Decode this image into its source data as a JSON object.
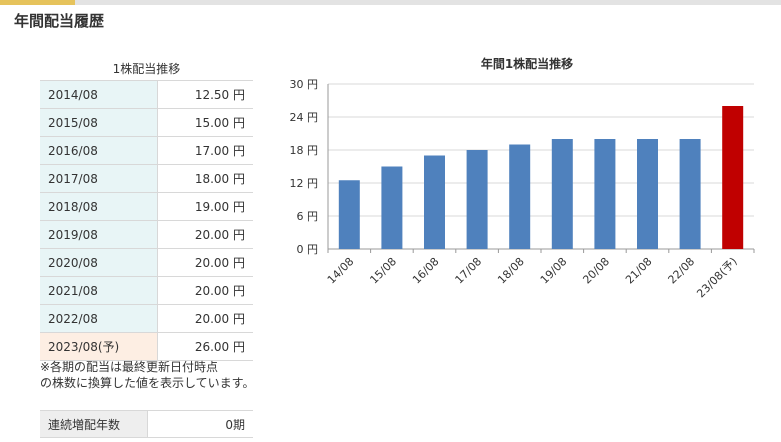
{
  "page": {
    "title": "年間配当履歴",
    "table_caption": "1株配当推移",
    "note_lines": [
      "※各期の配当は最終更新日付時点",
      "の株数に換算した値を表示しています。"
    ],
    "streak_label": "連続増配年数",
    "streak_value": "0期"
  },
  "rows": [
    {
      "period": "2014/08",
      "amount": "12.50 円"
    },
    {
      "period": "2015/08",
      "amount": "15.00 円"
    },
    {
      "period": "2016/08",
      "amount": "17.00 円"
    },
    {
      "period": "2017/08",
      "amount": "18.00 円"
    },
    {
      "period": "2018/08",
      "amount": "19.00 円"
    },
    {
      "period": "2019/08",
      "amount": "20.00 円"
    },
    {
      "period": "2020/08",
      "amount": "20.00 円"
    },
    {
      "period": "2021/08",
      "amount": "20.00 円"
    },
    {
      "period": "2022/08",
      "amount": "20.00 円"
    },
    {
      "period": "2023/08(予)",
      "amount": "26.00 円"
    }
  ],
  "chart_data": {
    "type": "bar",
    "title": "年間1株配当推移",
    "categories": [
      "14/08",
      "15/08",
      "16/08",
      "17/08",
      "18/08",
      "19/08",
      "20/08",
      "21/08",
      "22/08",
      "23/08(予)"
    ],
    "values": [
      12.5,
      15,
      17,
      18,
      19,
      20,
      20,
      20,
      20,
      26
    ],
    "ylim": [
      0,
      30
    ],
    "yticks": [
      0,
      6,
      12,
      18,
      24,
      30
    ],
    "ytick_labels": [
      "0 円",
      "6 円",
      "12 円",
      "18 円",
      "24 円",
      "30 円"
    ],
    "grid": true,
    "legend": "none",
    "colors": {
      "actual": "#4f81bd",
      "forecast": "#c00000"
    },
    "forecast_index": 9
  }
}
